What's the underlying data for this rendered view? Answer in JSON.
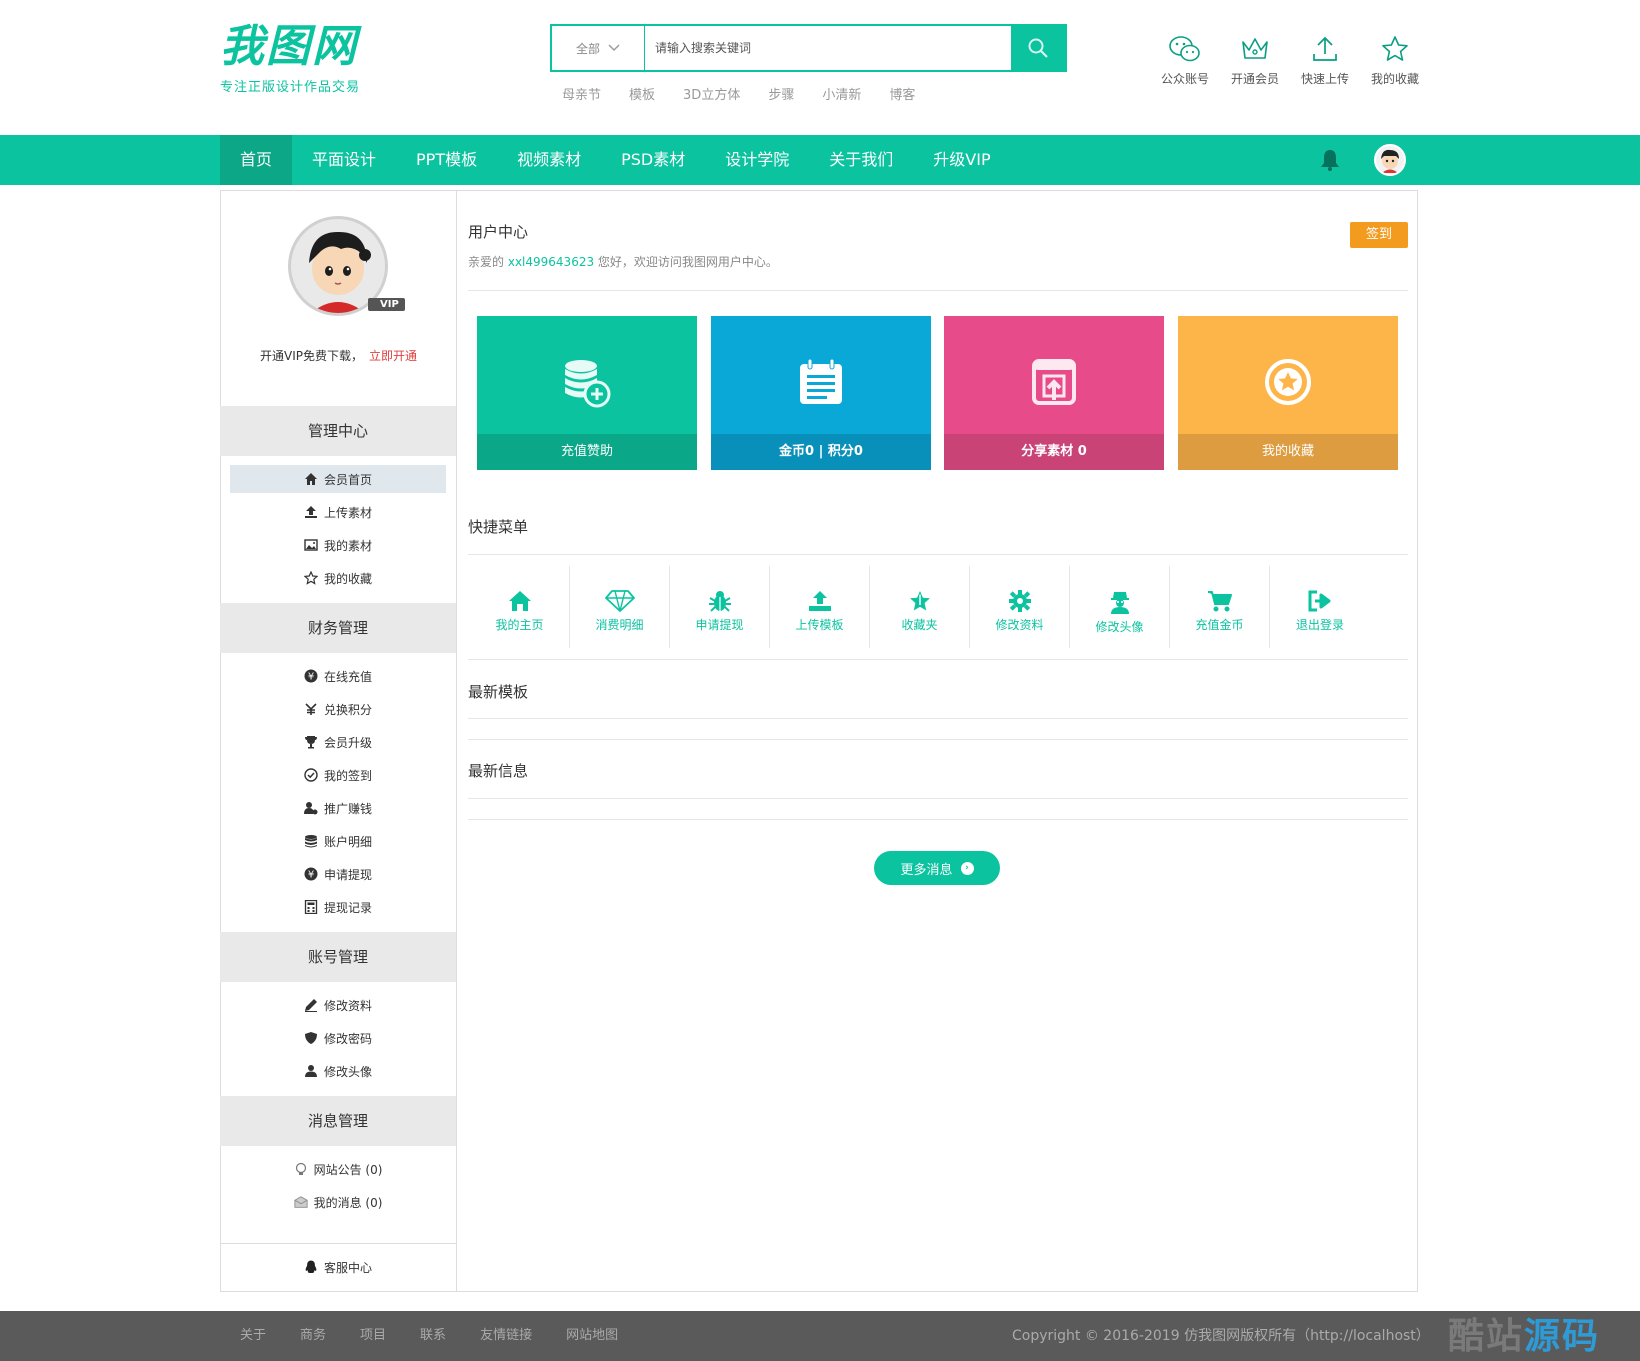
{
  "brand": {
    "logo_text": "我图网",
    "slogan": "专注正版设计作品交易",
    "accent": "#0cc3a0"
  },
  "search": {
    "category": "全部",
    "placeholder": "请输入搜索关键词",
    "hotwords": [
      "母亲节",
      "模板",
      "3D立方体",
      "步骤",
      "小清新",
      "博客"
    ]
  },
  "top_icons": [
    {
      "label": "公众账号",
      "icon": "wechat-icon"
    },
    {
      "label": "开通会员",
      "icon": "crown-icon"
    },
    {
      "label": "快速上传",
      "icon": "upload-icon"
    },
    {
      "label": "我的收藏",
      "icon": "star-icon"
    }
  ],
  "nav": {
    "items": [
      "首页",
      "平面设计",
      "PPT模板",
      "视频素材",
      "PSD素材",
      "设计学院",
      "关于我们",
      "升级VIP"
    ],
    "active_index": 0
  },
  "sidebar": {
    "vip_badge": "VIP",
    "vip_text": "开通VIP免费下载，",
    "vip_link": "立即开通",
    "sections": [
      {
        "title": "管理中心",
        "items": [
          {
            "label": "会员首页",
            "icon": "home-icon",
            "active": true
          },
          {
            "label": "上传素材",
            "icon": "upload-icon"
          },
          {
            "label": "我的素材",
            "icon": "image-icon"
          },
          {
            "label": "我的收藏",
            "icon": "star-icon"
          }
        ]
      },
      {
        "title": "财务管理",
        "items": [
          {
            "label": "在线充值",
            "icon": "yen-circle-icon"
          },
          {
            "label": "兑换积分",
            "icon": "exchange-icon"
          },
          {
            "label": "会员升级",
            "icon": "trophy-icon"
          },
          {
            "label": "我的签到",
            "icon": "check-circle-icon"
          },
          {
            "label": "推广赚钱",
            "icon": "user-money-icon"
          },
          {
            "label": "账户明细",
            "icon": "database-icon"
          },
          {
            "label": "申请提现",
            "icon": "yen-circle-icon"
          },
          {
            "label": "提现记录",
            "icon": "calculator-icon"
          }
        ]
      },
      {
        "title": "账号管理",
        "items": [
          {
            "label": "修改资料",
            "icon": "edit-icon"
          },
          {
            "label": "修改密码",
            "icon": "shield-icon"
          },
          {
            "label": "修改头像",
            "icon": "user-icon"
          }
        ]
      },
      {
        "title": "消息管理",
        "items": [
          {
            "label": "网站公告 (0)",
            "icon": "bulb-icon"
          },
          {
            "label": "我的消息 (0)",
            "icon": "envelope-icon"
          }
        ]
      }
    ],
    "service": "客服中心"
  },
  "main": {
    "title": "用户中心",
    "welcome_prefix": "亲爱的",
    "username": "xxl499643623",
    "welcome_suffix": "您好，欢迎访问我图网用户中心。",
    "signin": "签到",
    "cards": [
      {
        "label": "充值赞助",
        "icon": "coins-plus-icon",
        "color": "#0cc3a0",
        "foot_color": "#0aa888"
      },
      {
        "label": "金币0 | 积分0",
        "icon": "calendar-list-icon",
        "color": "#0aa8d6",
        "foot_color": "#0990ba"
      },
      {
        "label": "分享素材 0",
        "icon": "share-icon",
        "color": "#e84b8a",
        "foot_color": "#c94377"
      },
      {
        "label": "我的收藏",
        "icon": "star-circle-icon",
        "color": "#fdb54a",
        "foot_color": "#dc9c3f"
      }
    ],
    "quick_title": "快捷菜单",
    "quick_items": [
      {
        "label": "我的主页",
        "icon": "home-icon"
      },
      {
        "label": "消费明细",
        "icon": "diamond-icon"
      },
      {
        "label": "申请提现",
        "icon": "bug-icon"
      },
      {
        "label": "上传模板",
        "icon": "upload-icon"
      },
      {
        "label": "收藏夹",
        "icon": "star-icon"
      },
      {
        "label": "修改资料",
        "icon": "gear-icon"
      },
      {
        "label": "修改头像",
        "icon": "spy-icon"
      },
      {
        "label": "充值金币",
        "icon": "cart-icon"
      },
      {
        "label": "退出登录",
        "icon": "signout-icon"
      }
    ],
    "latest_templates": "最新模板",
    "latest_news": "最新信息",
    "more_button": "更多消息"
  },
  "footer": {
    "links": [
      "关于",
      "商务",
      "项目",
      "联系",
      "友情链接",
      "网站地图"
    ],
    "copyright": "Copyright © 2016-2019 仿我图网版权所有（http://localhost）",
    "watermark_a": "酷站",
    "watermark_b": "源码"
  }
}
